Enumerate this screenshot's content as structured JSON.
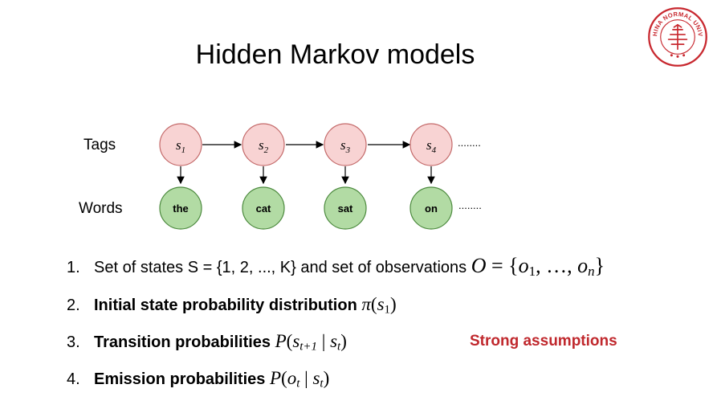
{
  "slide": {
    "title": "Hidden Markov models"
  },
  "logo": {
    "name": "EAST CHINA NORMAL UNIVERSITY",
    "color": "#c8282f"
  },
  "diagram": {
    "row_labels": {
      "tags": "Tags",
      "words": "Words"
    },
    "tags": [
      {
        "base": "s",
        "sub": "1"
      },
      {
        "base": "s",
        "sub": "2"
      },
      {
        "base": "s",
        "sub": "3"
      },
      {
        "base": "s",
        "sub": "4"
      }
    ],
    "words": [
      "the",
      "cat",
      "sat",
      "on"
    ],
    "ellipsis": "........",
    "colors": {
      "tag_fill": "#f8d3d3",
      "tag_stroke": "#c46a6a",
      "word_fill": "#b2dba4",
      "word_stroke": "#4c8a3e"
    }
  },
  "list": {
    "items": [
      {
        "number": "1.",
        "text": "Set of states S = {1, 2, ..., K} and set of observations",
        "math": {
          "lhs": "O",
          "eq": " = {",
          "o1": "o",
          "o1_sub": "1",
          "mid": ", …, ",
          "on": "o",
          "on_sub": "n",
          "close": "}"
        }
      },
      {
        "number": "2.",
        "text": "Initial state probability distribution",
        "math": {
          "fn": "π",
          "open": "(",
          "arg": "s",
          "arg_sub": "1",
          "close": ")"
        }
      },
      {
        "number": "3.",
        "text": "Transition probabilities",
        "math": {
          "fn": "P",
          "open": "(",
          "a": "s",
          "a_sub": "t+1",
          "bar": " | ",
          "b": "s",
          "b_sub": "t",
          "close": ")"
        }
      },
      {
        "number": "4.",
        "text": "Emission probabilities",
        "math": {
          "fn": "P",
          "open": "(",
          "a": "o",
          "a_sub": "t",
          "bar": " | ",
          "b": "s",
          "b_sub": "t",
          "close": ")"
        }
      }
    ]
  },
  "annotation": {
    "text": "Strong assumptions",
    "color": "#c0282d"
  }
}
